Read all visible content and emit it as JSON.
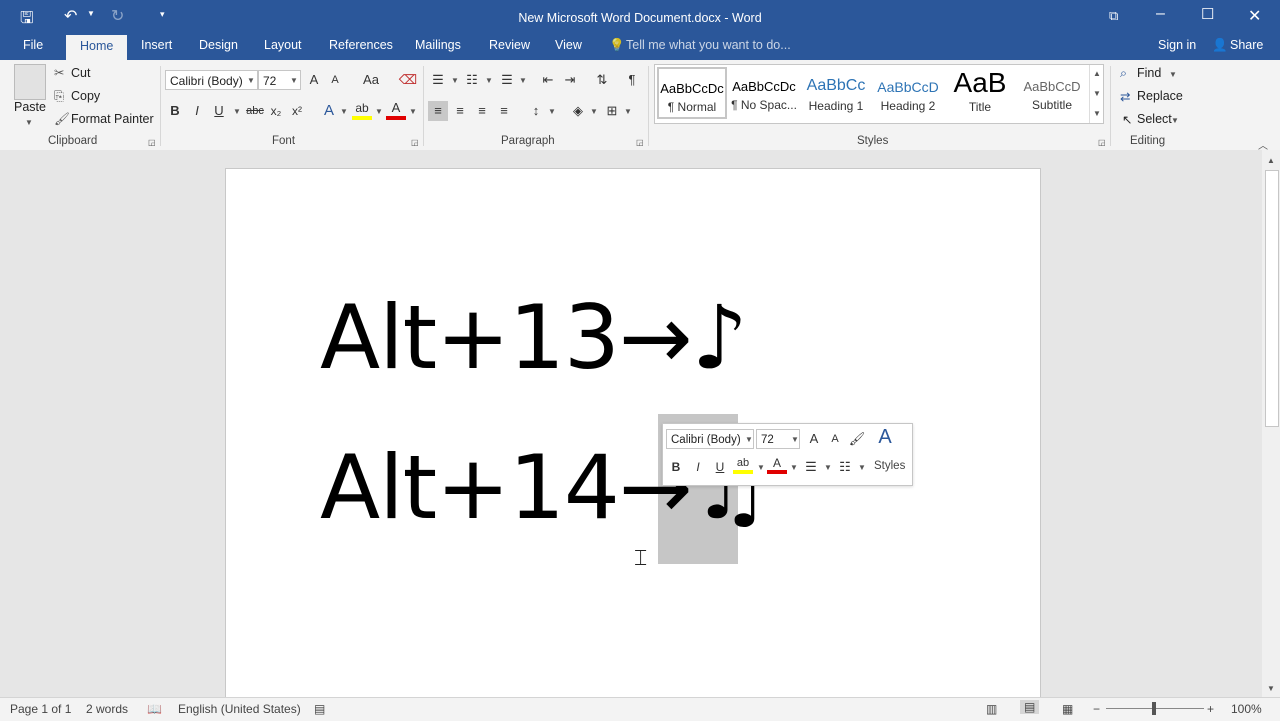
{
  "window": {
    "title": "New Microsoft Word Document.docx - Word"
  },
  "tabs": {
    "file": "File",
    "items": [
      "Home",
      "Insert",
      "Design",
      "Layout",
      "References",
      "Mailings",
      "Review",
      "View"
    ],
    "tell_me": "Tell me what you want to do...",
    "sign_in": "Sign in",
    "share": "Share"
  },
  "clipboard": {
    "paste": "Paste",
    "cut": "Cut",
    "copy": "Copy",
    "format_painter": "Format Painter",
    "label": "Clipboard"
  },
  "font": {
    "family": "Calibri (Body)",
    "size": "72",
    "label": "Font",
    "bold": "B",
    "italic": "I",
    "underline": "U",
    "strike": "abc",
    "subscript": "x₂",
    "superscript": "x²",
    "grow": "A",
    "shrink": "A",
    "case": "Aa",
    "effects": "A",
    "color": "A"
  },
  "paragraph": {
    "label": "Paragraph"
  },
  "styles": {
    "label": "Styles",
    "items": [
      {
        "preview": "AaBbCcDc",
        "name": "¶ Normal"
      },
      {
        "preview": "AaBbCcDc",
        "name": "¶ No Spac..."
      },
      {
        "preview": "AaBbCc",
        "name": "Heading 1"
      },
      {
        "preview": "AaBbCcD",
        "name": "Heading 2"
      },
      {
        "preview": "AaB",
        "name": "Title"
      },
      {
        "preview": "AaBbCcD",
        "name": "Subtitle"
      }
    ]
  },
  "editing": {
    "find": "Find",
    "replace": "Replace",
    "select": "Select",
    "label": "Editing"
  },
  "document": {
    "line1": "Alt+13→♪",
    "line2_text": "Alt+14→",
    "line2_selected": "♫"
  },
  "mini_toolbar": {
    "font": "Calibri (Body)",
    "size": "72",
    "styles": "Styles"
  },
  "status": {
    "page": "Page 1 of 1",
    "words": "2 words",
    "language": "English (United States)",
    "zoom": "100%"
  },
  "colors": {
    "brand": "#2b579a",
    "highlight": "#ffff00",
    "font_color": "#e00000"
  }
}
